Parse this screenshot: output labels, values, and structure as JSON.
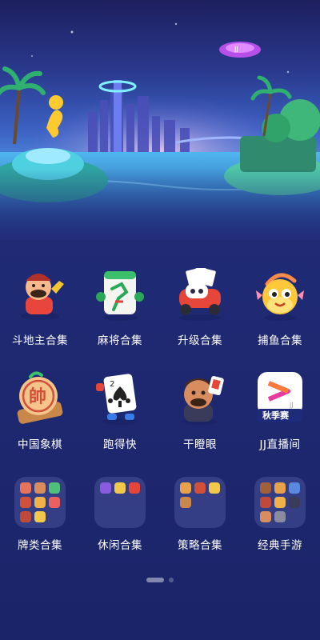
{
  "apps": [
    {
      "label": "斗地主合集",
      "icon": "landlord-character-icon"
    },
    {
      "label": "麻将合集",
      "icon": "mahjong-tile-icon"
    },
    {
      "label": "升级合集",
      "icon": "race-car-cards-icon"
    },
    {
      "label": "捕鱼合集",
      "icon": "fish-icon"
    },
    {
      "label": "中国象棋",
      "icon": "chinese-chess-piece-icon"
    },
    {
      "label": "跑得快",
      "icon": "running-card-icon"
    },
    {
      "label": "干瞪眼",
      "icon": "staring-character-icon"
    },
    {
      "label": "JJ直播间",
      "icon": "jj-live-icon",
      "badge": "秋季赛",
      "badge_small": "JJ"
    },
    {
      "label": "牌类合集",
      "icon": "folder-icon"
    },
    {
      "label": "休闲合集",
      "icon": "folder-icon"
    },
    {
      "label": "策略合集",
      "icon": "folder-icon"
    },
    {
      "label": "经典手游",
      "icon": "folder-icon"
    }
  ],
  "hero": {
    "blimp_text": "JJ"
  },
  "pager": {
    "pages": 2,
    "current": 1
  },
  "colors": {
    "background": "#232d7a",
    "label": "#ffffff"
  }
}
